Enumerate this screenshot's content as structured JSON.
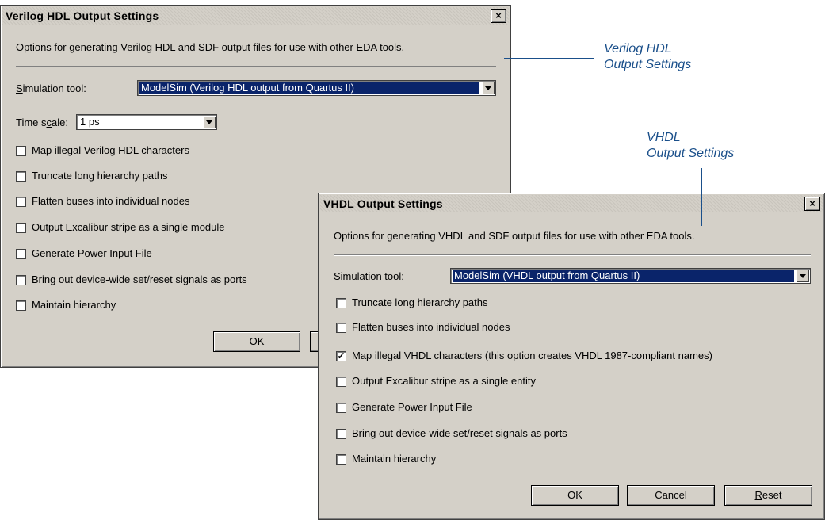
{
  "verilog_dialog": {
    "title": "Verilog HDL Output Settings",
    "close_label": "×",
    "description": "Options for generating Verilog HDL and SDF output files for use with other EDA tools.",
    "simulation_tool_label": "Simulation tool:",
    "simulation_tool_value": "ModelSim (Verilog HDL output from Quartus II)",
    "time_scale_label": "Time scale:",
    "time_scale_value": "1 ps",
    "options": [
      {
        "label": "Map illegal Verilog HDL characters",
        "checked": false
      },
      {
        "label": "Truncate long hierarchy paths",
        "checked": false
      },
      {
        "label": "Flatten buses into individual nodes",
        "checked": false
      },
      {
        "label": "Output Excalibur stripe as a single module",
        "checked": false
      },
      {
        "label": "Generate Power Input File",
        "checked": false
      },
      {
        "label": "Bring out device-wide set/reset signals as ports",
        "checked": false
      },
      {
        "label": "Maintain hierarchy",
        "checked": false
      }
    ],
    "ok_label": "OK"
  },
  "vhdl_dialog": {
    "title": "VHDL Output Settings",
    "close_label": "×",
    "description": "Options for generating VHDL and SDF output files for use with other EDA tools.",
    "simulation_tool_label": "Simulation tool:",
    "simulation_tool_value": "ModelSim (VHDL output from Quartus II)",
    "options": [
      {
        "label": "Truncate long hierarchy paths",
        "checked": false
      },
      {
        "label": "Flatten buses into individual nodes",
        "checked": false
      },
      {
        "label": "Map illegal VHDL characters (this option creates VHDL 1987-compliant names)",
        "checked": true
      },
      {
        "label": "Output Excalibur stripe as a single entity",
        "checked": false
      },
      {
        "label": "Generate Power Input File",
        "checked": false
      },
      {
        "label": "Bring out device-wide set/reset signals as ports",
        "checked": false
      },
      {
        "label": "Maintain hierarchy",
        "checked": false
      }
    ],
    "ok_label": "OK",
    "cancel_label": "Cancel",
    "reset_label": "Reset"
  },
  "callouts": {
    "verilog": {
      "line1": "Verilog HDL",
      "line2": "Output Settings"
    },
    "vhdl": {
      "line1": "VHDL",
      "line2": "Output Settings"
    }
  },
  "colors": {
    "callout": "#1a4f8a",
    "dialog_face": "#d4d0c8",
    "selection": "#0a246a"
  }
}
